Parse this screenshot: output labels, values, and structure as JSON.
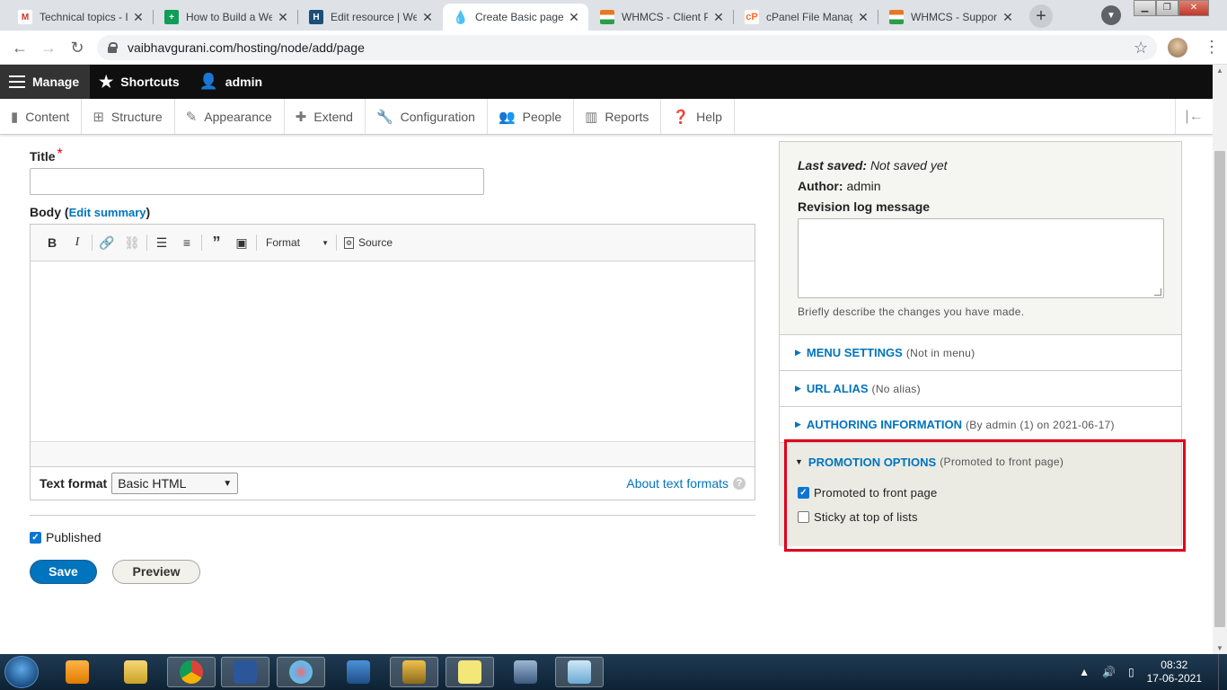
{
  "browser": {
    "tabs": [
      {
        "title": "Technical topics - I",
        "icon": "gmail-icon",
        "color": "#d93025",
        "glyph": "M"
      },
      {
        "title": "How to Build a We",
        "icon": "docs-plus-icon",
        "color": "#0f9d58",
        "glyph": "+"
      },
      {
        "title": "Edit resource | We",
        "icon": "h-icon",
        "color": "#1a4f7a",
        "glyph": "H"
      },
      {
        "title": "Create Basic page",
        "icon": "drupal-icon",
        "color": "#0678be",
        "glyph": "◆"
      },
      {
        "title": "WHMCS - Client P",
        "icon": "whmcs-icon",
        "color": "#e87722",
        "glyph": "≡"
      },
      {
        "title": "cPanel File Manag",
        "icon": "cpanel-icon",
        "color": "#ff6c2c",
        "glyph": "cP"
      },
      {
        "title": "WHMCS - Suppor",
        "icon": "whmcs-icon",
        "color": "#e87722",
        "glyph": "≡"
      }
    ],
    "url": "vaibhavgurani.com/hosting/node/add/page"
  },
  "toolbar": {
    "manage": "Manage",
    "shortcuts": "Shortcuts",
    "user": "admin"
  },
  "tray": {
    "items": [
      {
        "label": "Content",
        "icon": "content-icon",
        "glyph": "▯"
      },
      {
        "label": "Structure",
        "icon": "structure-icon",
        "glyph": "⊞"
      },
      {
        "label": "Appearance",
        "icon": "appearance-icon",
        "glyph": "✎"
      },
      {
        "label": "Extend",
        "icon": "extend-icon",
        "glyph": "✚"
      },
      {
        "label": "Configuration",
        "icon": "wrench-icon",
        "glyph": "🔧"
      },
      {
        "label": "People",
        "icon": "people-icon",
        "glyph": "👤"
      },
      {
        "label": "Reports",
        "icon": "reports-icon",
        "glyph": "▮"
      },
      {
        "label": "Help",
        "icon": "help-icon",
        "glyph": "?"
      }
    ]
  },
  "form": {
    "title_label": "Title",
    "title_value": "",
    "body_label": "Body",
    "edit_summary": "Edit summary",
    "format_label": "Format",
    "source_label": "Source",
    "text_format_label": "Text format",
    "text_format_value": "Basic HTML",
    "about_text_formats": "About text formats",
    "published_label": "Published",
    "published_checked": true,
    "save_label": "Save",
    "preview_label": "Preview"
  },
  "sidebar": {
    "last_saved_label": "Last saved:",
    "last_saved_value": "Not saved yet",
    "author_label": "Author:",
    "author_value": "admin",
    "revision_label": "Revision log message",
    "revision_desc": "Briefly describe the changes you have made.",
    "sections": [
      {
        "title": "MENU SETTINGS",
        "summary": "(Not in menu)"
      },
      {
        "title": "URL ALIAS",
        "summary": "(No alias)"
      },
      {
        "title": "AUTHORING INFORMATION",
        "summary": "(By admin (1) on 2021-06-17)"
      }
    ],
    "promotion": {
      "title": "PROMOTION OPTIONS",
      "summary": "(Promoted to front page)",
      "options": [
        {
          "label": "Promoted to front page",
          "checked": true
        },
        {
          "label": "Sticky at top of lists",
          "checked": false
        }
      ]
    }
  },
  "taskbar": {
    "time": "08:32",
    "date": "17-06-2021"
  },
  "colors": {
    "accent": "#0074bd",
    "highlight": "#e0001b"
  }
}
